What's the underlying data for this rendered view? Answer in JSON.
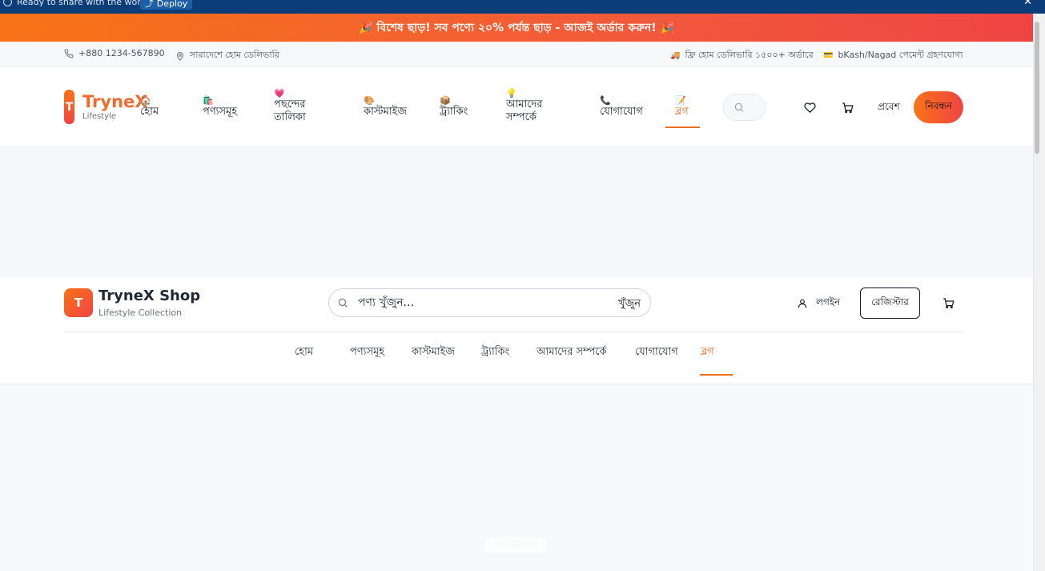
{
  "browser_bar": {
    "message": "Ready to share with the world?",
    "deploy_label": "Deploy",
    "close_label": "✕"
  },
  "promo": {
    "text": "🎉 বিশেষ ছাড়! সব পণ্যে ২০% পর্যন্ত ছাড় - আজই অর্ডার করুন! 🎉"
  },
  "infobar": {
    "phone": "+880 1234-567890",
    "delivery_area": "সারাদেশে হোম ডেলিভারি",
    "free_delivery": "ফ্রি হোম ডেলিভারি ১৫০০+ অর্ডারে",
    "payment": "bKash/Nagad পেমেন্ট গ্রহণযোগ্য"
  },
  "header1": {
    "logo_letter": "T",
    "logo_name": "TryneX",
    "logo_sub": "Lifestyle",
    "nav": [
      {
        "emoji": "🏠",
        "label": "হোম"
      },
      {
        "emoji": "🛍️",
        "label": "পণ্যসমূহ"
      },
      {
        "emoji": "💗",
        "label": "পছন্দের তালিকা"
      },
      {
        "emoji": "🎨",
        "label": "কাস্টমাইজ"
      },
      {
        "emoji": "📦",
        "label": "ট্র্যাকিং"
      },
      {
        "emoji": "💡",
        "label": "আমাদের সম্পর্কে"
      },
      {
        "emoji": "📞",
        "label": "যোগাযোগ"
      },
      {
        "emoji": "📝",
        "label": "ব্লগ"
      }
    ],
    "login_label": "প্রবেশ",
    "register_label": "নিবন্ধন"
  },
  "header2": {
    "logo_letter": "T",
    "logo_name": "TryneX Shop",
    "logo_sub": "Lifestyle Collection",
    "search_placeholder": "পণ্য খুঁজুন...",
    "search_button": "খুঁজুন",
    "login_label": "লগইন",
    "register_label": "রেজিস্টার",
    "nav": [
      "হোম",
      "পণ্যসমূহ",
      "কাস্টমাইজ",
      "ট্র্যাকিং",
      "আমাদের সম্পর্কে",
      "যোগাযোগ",
      "ব্লগ"
    ]
  },
  "toast": {
    "text": "আপডেট হচ্ছে"
  },
  "colors": {
    "accent": "#ef6b1f",
    "gradient_start": "#f97316",
    "gradient_end": "#ef4444",
    "top_bar": "#0b3d78"
  }
}
